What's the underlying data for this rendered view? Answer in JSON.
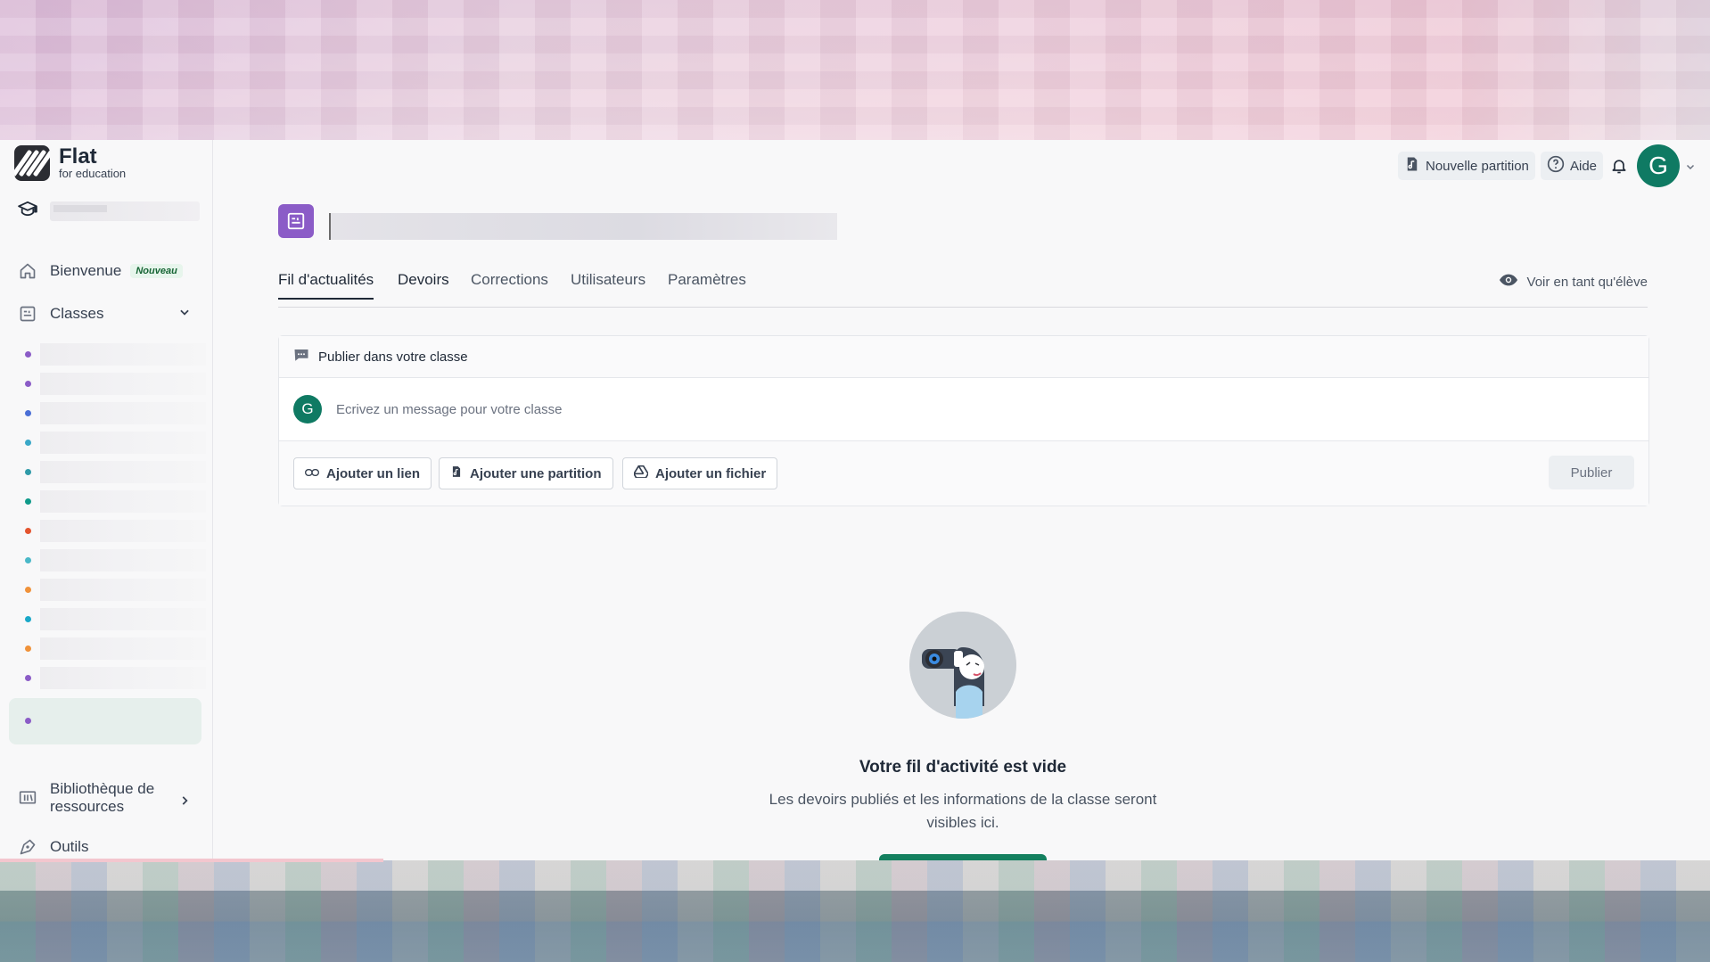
{
  "brand": {
    "name": "Flat",
    "subtitle": "for education"
  },
  "sidebar": {
    "welcome": {
      "label": "Bienvenue",
      "badge": "Nouveau"
    },
    "classes": {
      "label": "Classes"
    },
    "class_dots": [
      "#8b5cc7",
      "#8b5cc7",
      "#4a6fd6",
      "#3aa8c8",
      "#2f9aa8",
      "#0f9a8a",
      "#e4542e",
      "#4ab8c8",
      "#f0923a",
      "#1aa8c8",
      "#f0923a",
      "#8b5cc7",
      "#8b5cc7"
    ],
    "library": {
      "label_line1": "Bibliothèque de",
      "label_line2": "ressources"
    },
    "tools": {
      "label": "Outils"
    }
  },
  "header": {
    "new_score": "Nouvelle partition",
    "help": "Aide",
    "avatar_initial": "G"
  },
  "tabs": {
    "feed": "Fil d'actualités",
    "assignments": "Devoirs",
    "corrections": "Corrections",
    "users": "Utilisateurs",
    "settings": "Paramètres",
    "view_as_student": "Voir en tant qu'élève"
  },
  "composer": {
    "heading": "Publier dans votre classe",
    "avatar_initial": "G",
    "placeholder": "Ecrivez un message pour votre classe",
    "add_link": "Ajouter un lien",
    "add_score": "Ajouter une partition",
    "add_file": "Ajouter un fichier",
    "publish": "Publier"
  },
  "empty_state": {
    "title": "Votre fil d'activité est vide",
    "description": "Les devoirs publiés et les informations de la classe seront visibles ici."
  }
}
